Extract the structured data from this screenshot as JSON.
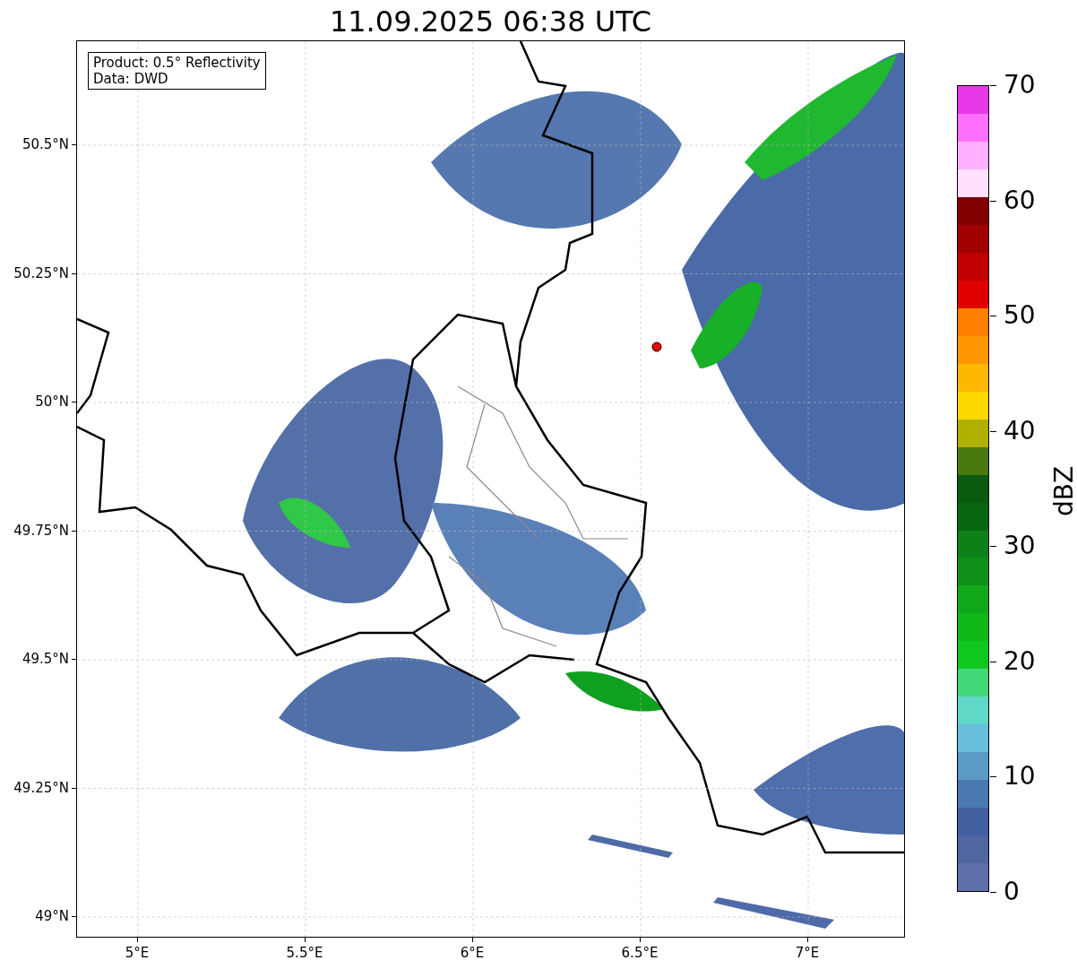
{
  "title": "11.09.2025 06:38 UTC",
  "info_box": [
    "Product: 0.5° Reflectivity",
    "Data: DWD"
  ],
  "map": {
    "x_ticks": [
      "5°E",
      "5.5°E",
      "6°E",
      "6.5°E",
      "7°E"
    ],
    "y_ticks": [
      "50.5°N",
      "50.25°N",
      "50°N",
      "49.75°N",
      "49.5°N",
      "49.25°N",
      "49°N"
    ]
  },
  "colorbar": {
    "label": "dBZ",
    "ticks": [
      "70",
      "60",
      "50",
      "40",
      "30",
      "20",
      "10",
      "0"
    ],
    "bands": [
      {
        "color": "#e838e8"
      },
      {
        "color": "#ff70ff"
      },
      {
        "color": "#ffb0ff"
      },
      {
        "color": "#ffe0ff"
      },
      {
        "color": "#800000"
      },
      {
        "color": "#a00000"
      },
      {
        "color": "#c00000"
      },
      {
        "color": "#e00000"
      },
      {
        "color": "#ff8000"
      },
      {
        "color": "#ff9800"
      },
      {
        "color": "#ffb800"
      },
      {
        "color": "#ffd800"
      },
      {
        "color": "#b0b000"
      },
      {
        "color": "#4a7810"
      },
      {
        "color": "#0a5a10"
      },
      {
        "color": "#086810"
      },
      {
        "color": "#0e8018"
      },
      {
        "color": "#0e9018"
      },
      {
        "color": "#10a818"
      },
      {
        "color": "#10b818"
      },
      {
        "color": "#10c820"
      },
      {
        "color": "#40d878"
      },
      {
        "color": "#60d8c8"
      },
      {
        "color": "#68c0dc"
      },
      {
        "color": "#5a9ac4"
      },
      {
        "color": "#4a78b0"
      },
      {
        "color": "#4060a0"
      },
      {
        "color": "#5066a0"
      },
      {
        "color": "#6070a8"
      }
    ]
  }
}
